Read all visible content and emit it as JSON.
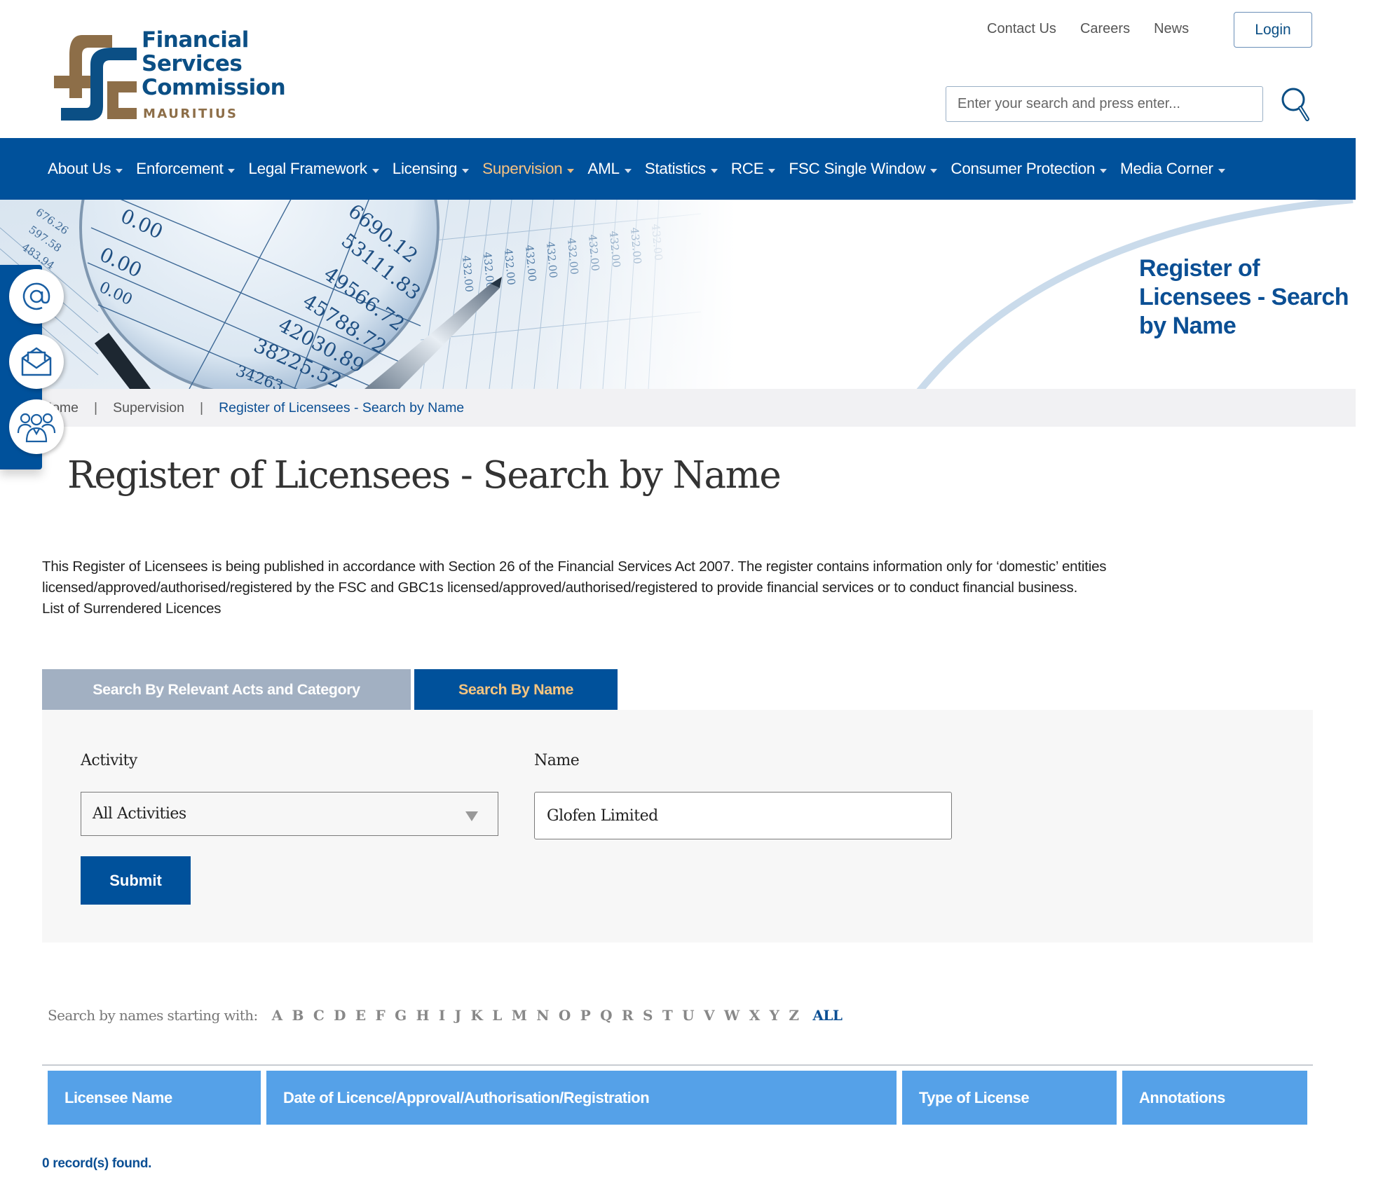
{
  "brand": {
    "name_lines": [
      "Financial",
      "Services",
      "Commission"
    ],
    "country": "MAURITIUS",
    "colors": {
      "blue": "#0b4f85",
      "bronze": "#8d6e48"
    }
  },
  "header": {
    "top_links": [
      "Contact Us",
      "Careers",
      "News"
    ],
    "login_label": "Login",
    "search_placeholder": "Enter your search and press enter...",
    "search_icon": "search-icon"
  },
  "nav": {
    "items": [
      {
        "label": "About Us",
        "active": false
      },
      {
        "label": "Enforcement",
        "active": false
      },
      {
        "label": "Legal Framework",
        "active": false
      },
      {
        "label": "Licensing",
        "active": false
      },
      {
        "label": "Supervision",
        "active": true
      },
      {
        "label": "AML",
        "active": false
      },
      {
        "label": "Statistics",
        "active": false
      },
      {
        "label": "RCE",
        "active": false
      },
      {
        "label": "FSC Single Window",
        "active": false
      },
      {
        "label": "Consumer Protection",
        "active": false
      },
      {
        "label": "Media Corner",
        "active": false
      }
    ],
    "colors": {
      "background": "#00519b",
      "active": "#f6c281"
    }
  },
  "banner": {
    "title": "Register of Licensees - Search by Name",
    "image_numbers": [
      "0.00",
      "0.00",
      "0.00",
      "53111.83",
      "49566.72",
      "45788.72",
      "42030.89",
      "38225.52",
      "676.26",
      "597.58",
      "483.94",
      "432.00"
    ]
  },
  "breadcrumb": {
    "items": [
      "Home",
      "Supervision",
      "Register of Licensees - Search by Name"
    ]
  },
  "side_widget": {
    "icons": [
      "at-sign-icon",
      "envelope-icon",
      "people-group-icon"
    ]
  },
  "page": {
    "title": "Register of Licensees - Search by Name",
    "intro_lines": [
      "This Register of Licensees is being published in accordance with Section 26 of the Financial Services Act 2007. The register contains information only for ‘domestic’ entities",
      "licensed/approved/authorised/registered by the FSC and GBC1s licensed/approved/authorised/registered to provide financial services or to conduct financial business."
    ],
    "surrendered_link": "List of Surrendered Licences"
  },
  "tabs": [
    {
      "label": "Search By Relevant Acts and Category",
      "active": false
    },
    {
      "label": "Search By Name",
      "active": true
    }
  ],
  "form": {
    "activity_label": "Activity",
    "activity_value": "All Activities",
    "name_label": "Name",
    "name_value": "Glofen Limited",
    "submit_label": "Submit"
  },
  "alpha_filter": {
    "label": "Search by names starting with:",
    "letters": [
      "A",
      "B",
      "C",
      "D",
      "E",
      "F",
      "G",
      "H",
      "I",
      "J",
      "K",
      "L",
      "M",
      "N",
      "O",
      "P",
      "Q",
      "R",
      "S",
      "T",
      "U",
      "V",
      "W",
      "X",
      "Y",
      "Z"
    ],
    "all_label": "ALL"
  },
  "table": {
    "columns": [
      "Licensee Name",
      "Date of Licence/Approval/Authorisation/Registration",
      "Type of License",
      "Annotations"
    ],
    "rows": [],
    "header_color": "#55a1e8"
  },
  "results": {
    "count": 0,
    "message": "0 record(s) found."
  }
}
